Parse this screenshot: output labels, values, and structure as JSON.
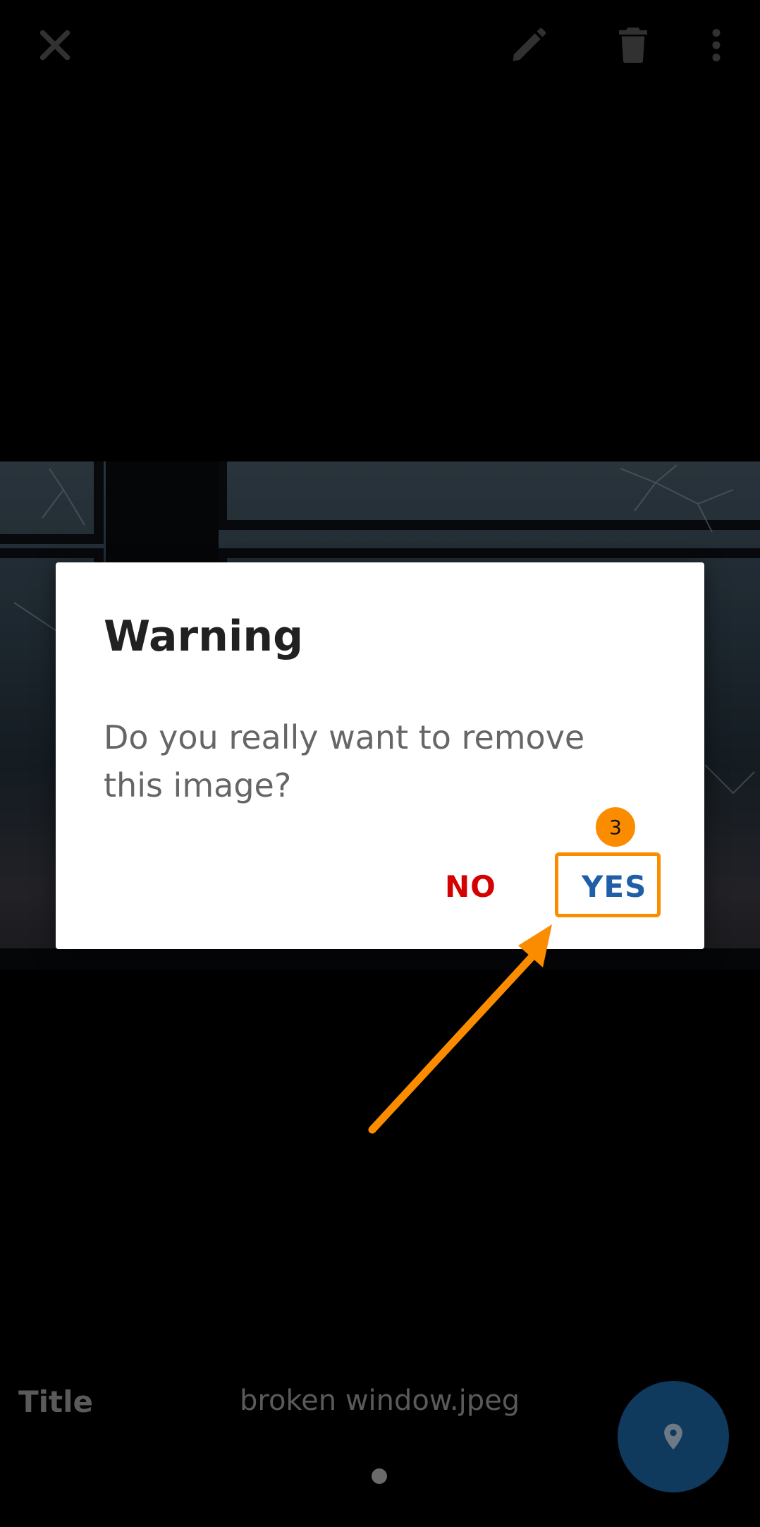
{
  "toolbar": {
    "close_icon": "close-icon",
    "edit_icon": "pencil-icon",
    "delete_icon": "trash-icon",
    "more_icon": "more-vert-icon"
  },
  "dialog": {
    "title": "Warning",
    "message": "Do you really want to remove this image?",
    "no_label": "NO",
    "yes_label": "YES"
  },
  "annotation": {
    "step_number": "3",
    "color": "#fb8c00"
  },
  "info": {
    "label": "Title",
    "value": "broken window.jpeg"
  },
  "fab": {
    "icon": "location-pin-icon"
  },
  "colors": {
    "no_button": "#d50000",
    "yes_button": "#1e5fa8",
    "fab": "#0f3a5e"
  }
}
